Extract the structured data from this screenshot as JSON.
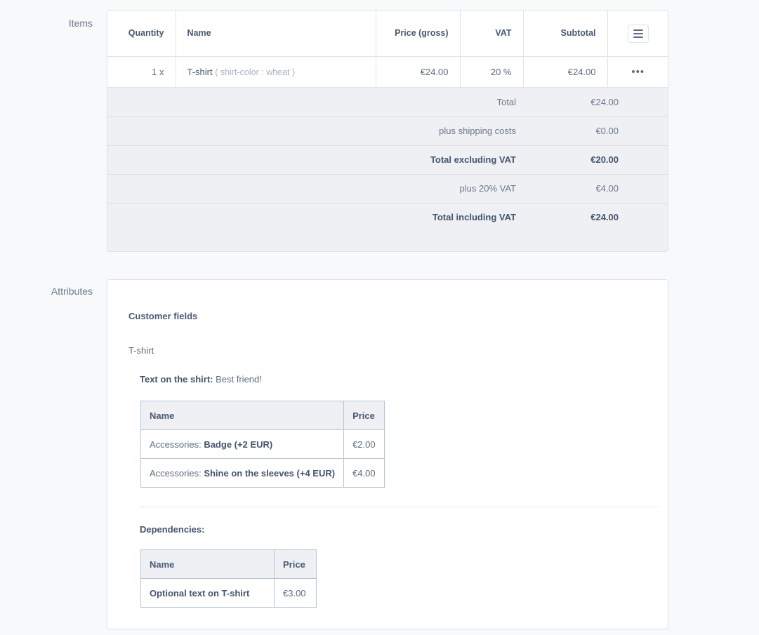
{
  "items_section": {
    "label": "Items",
    "table": {
      "columns": [
        {
          "key": "quantity",
          "label": "Quantity"
        },
        {
          "key": "name",
          "label": "Name"
        },
        {
          "key": "price",
          "label": "Price (gross)"
        },
        {
          "key": "vat",
          "label": "VAT"
        },
        {
          "key": "subtotal",
          "label": "Subtotal"
        },
        {
          "key": "actions",
          "label": ""
        }
      ],
      "header_menu_icon": "hamburger-menu-icon",
      "rows": [
        {
          "quantity": "1 x",
          "name": "T-shirt",
          "name_option": "( shirt-color : wheat )",
          "price": "€24.00",
          "vat": "20 %",
          "subtotal": "€24.00",
          "actions_icon": "ellipsis-icon",
          "actions_label": "•••"
        }
      ]
    },
    "totals": [
      {
        "label": "Total",
        "value": "€24.00",
        "strong": false
      },
      {
        "label": "plus shipping costs",
        "value": "€0.00",
        "strong": false
      },
      {
        "label": "Total excluding VAT",
        "value": "€20.00",
        "strong": true
      },
      {
        "label": "plus 20% VAT",
        "value": "€4.00",
        "strong": false
      },
      {
        "label": "Total including VAT",
        "value": "€24.00",
        "strong": true
      }
    ]
  },
  "attributes_section": {
    "label": "Attributes",
    "customer_fields_heading": "Customer fields",
    "product_name": "T-shirt",
    "text_field": {
      "label": "Text on the shirt:",
      "value": "Best friend!"
    },
    "accessories_table": {
      "columns": [
        "Name",
        "Price"
      ],
      "rows": [
        {
          "prefix": "Accessories: ",
          "name": "Badge (+2 EUR)",
          "price": "€2.00"
        },
        {
          "prefix": "Accessories: ",
          "name": "Shine on the sleeves (+4 EUR)",
          "price": "€4.00"
        }
      ]
    },
    "dependencies_heading": "Dependencies:",
    "dependencies_table": {
      "columns": [
        "Name",
        "Price"
      ],
      "rows": [
        {
          "name": "Optional text on T-shirt",
          "price": "€3.00"
        }
      ]
    }
  },
  "colors": {
    "page_background": "#f7f9fb",
    "card_background": "#ffffff",
    "card_border": "#dbe2e8",
    "totals_background": "#eef0f4",
    "table_header_background": "#eef0f4",
    "attr_table_border": "#b9c4d2",
    "text_primary": "#45556c",
    "text_secondary": "#5d6b7f",
    "text_muted": "#a9b4c0",
    "label_color": "#6a7b8d"
  }
}
